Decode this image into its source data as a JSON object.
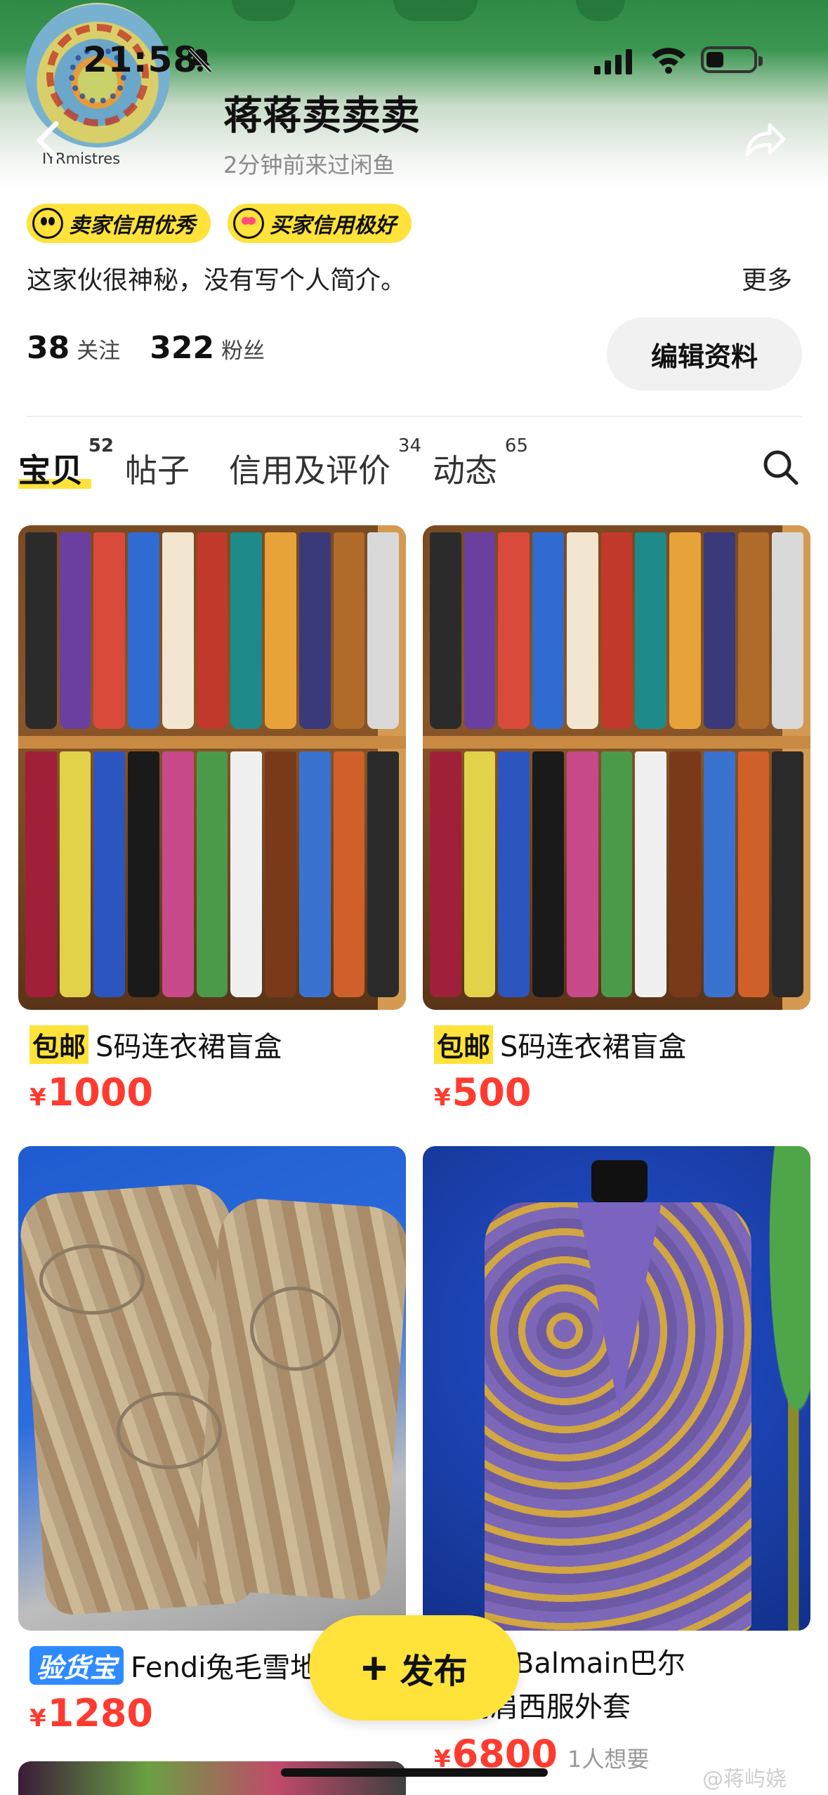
{
  "status_bar": {
    "time": "21:58"
  },
  "profile": {
    "avatar_text": "IYRmistres",
    "name": "蒋蒋卖卖卖",
    "last_visit": "2分钟前来过闲鱼",
    "badges": [
      {
        "label": "卖家信用优秀",
        "icon": "grin-face-icon"
      },
      {
        "label": "买家信用极好",
        "icon": "heart-eyes-face-icon"
      }
    ],
    "bio": "这家伙很神秘，没有写个人简介。",
    "more_label": "更多",
    "following_count": "38",
    "following_label": "关注",
    "fans_count": "322",
    "fans_label": "粉丝",
    "edit_label": "编辑资料"
  },
  "tabs": [
    {
      "label": "宝贝",
      "count": "52",
      "active": true
    },
    {
      "label": "帖子",
      "count": ""
    },
    {
      "label": "信用及评价",
      "count": "34"
    },
    {
      "label": "动态",
      "count": "65"
    }
  ],
  "items": [
    {
      "tag": "包邮",
      "title": "S码连衣裙盲盒",
      "currency": "¥",
      "price": "1000",
      "image": "wardrobe-photo"
    },
    {
      "tag": "包邮",
      "title": "S码连衣裙盲盒",
      "currency": "¥",
      "price": "500",
      "image": "wardrobe-photo"
    },
    {
      "tag": "验货宝",
      "title": "Fendi兔毛雪地",
      "currency": "¥",
      "price": "1280",
      "image": "fur-boots-photo"
    },
    {
      "tag": "",
      "title": "PierreBalmain巴尔",
      "title_line2": "款高肩西服外套",
      "currency": "¥",
      "price": "6800",
      "want": "1人想要",
      "image": "purple-blazer-photo"
    }
  ],
  "fab": {
    "label": "发布"
  },
  "watermark": "@蒋屿娆",
  "colors": {
    "accent_yellow": "#ffe23a",
    "price_red": "#ff3b30",
    "verified_blue": "#2d8bff"
  }
}
